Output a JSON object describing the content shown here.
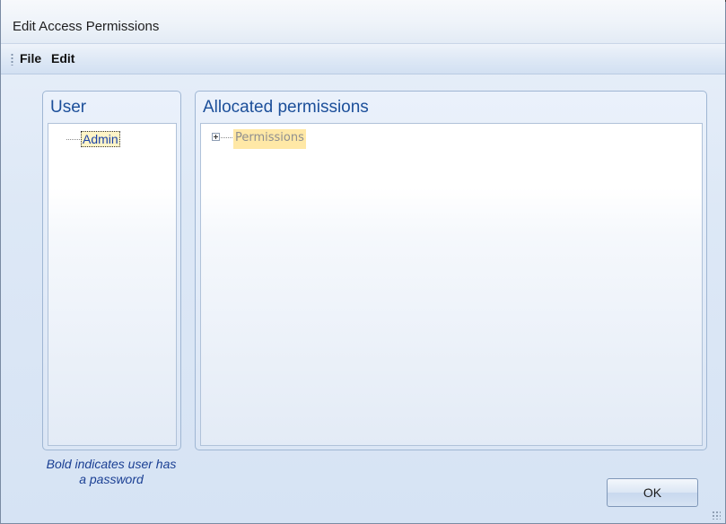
{
  "window": {
    "title": "Edit Access Permissions"
  },
  "menu": {
    "items": [
      {
        "label": "File"
      },
      {
        "label": "Edit"
      }
    ]
  },
  "user_panel": {
    "header": "User",
    "users": [
      {
        "name": "Admin",
        "selected": true
      }
    ],
    "hint": "Bold indicates user has a password"
  },
  "permissions_panel": {
    "header": "Allocated permissions",
    "tree": [
      {
        "label": "Permissions",
        "expanded": false,
        "selected": true
      }
    ]
  },
  "buttons": {
    "ok": "OK"
  },
  "colors": {
    "header_text": "#1c4f9a",
    "hint_text": "#1a3f93",
    "selection": "#ffe8a6"
  },
  "icons": {
    "expander": "plus-box-icon",
    "menu_grip": "grip-dots-icon",
    "resize": "resize-grip-icon"
  }
}
